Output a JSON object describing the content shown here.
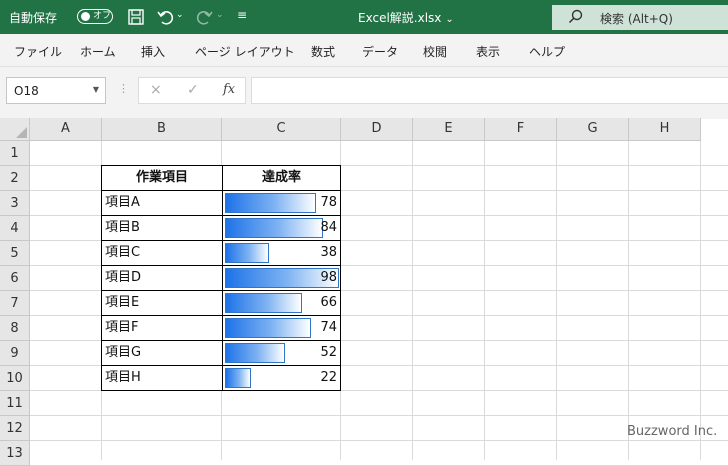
{
  "titlebar": {
    "autosave_label": "自動保存",
    "autosave_state": "オフ",
    "filename": "Excel解説.xlsx",
    "search_placeholder": "検索 (Alt+Q)",
    "icons": [
      "save-icon",
      "undo-icon",
      "redo-icon",
      "customize-qat-icon",
      "search-icon"
    ]
  },
  "menu": {
    "items": [
      "ファイル",
      "ホーム",
      "挿入",
      "ページ レイアウト",
      "数式",
      "データ",
      "校閲",
      "表示",
      "ヘルプ"
    ]
  },
  "formula_bar": {
    "name_box": "O18",
    "cancel_icon": "×",
    "enter_icon": "✓",
    "fx_label": "fx",
    "formula": ""
  },
  "sheet": {
    "columns": [
      "A",
      "B",
      "C",
      "D",
      "E",
      "F",
      "G",
      "H"
    ],
    "rows": [
      "1",
      "2",
      "3",
      "4",
      "5",
      "6",
      "7",
      "8",
      "9",
      "10",
      "11",
      "12",
      "13"
    ]
  },
  "table": {
    "header": [
      "作業項目",
      "達成率"
    ],
    "rows": [
      {
        "name": "項目A",
        "value": "78"
      },
      {
        "name": "項目B",
        "value": "84"
      },
      {
        "name": "項目C",
        "value": "38"
      },
      {
        "name": "項目D",
        "value": "98"
      },
      {
        "name": "項目E",
        "value": "66"
      },
      {
        "name": "項目F",
        "value": "74"
      },
      {
        "name": "項目G",
        "value": "52"
      },
      {
        "name": "項目H",
        "value": "22"
      }
    ],
    "databar_max": 98,
    "databar_color": "#1e73e8"
  },
  "watermark": "Buzzword Inc.",
  "colors": {
    "titlebar": "#217346",
    "ribbon": "#f3f3f3"
  }
}
